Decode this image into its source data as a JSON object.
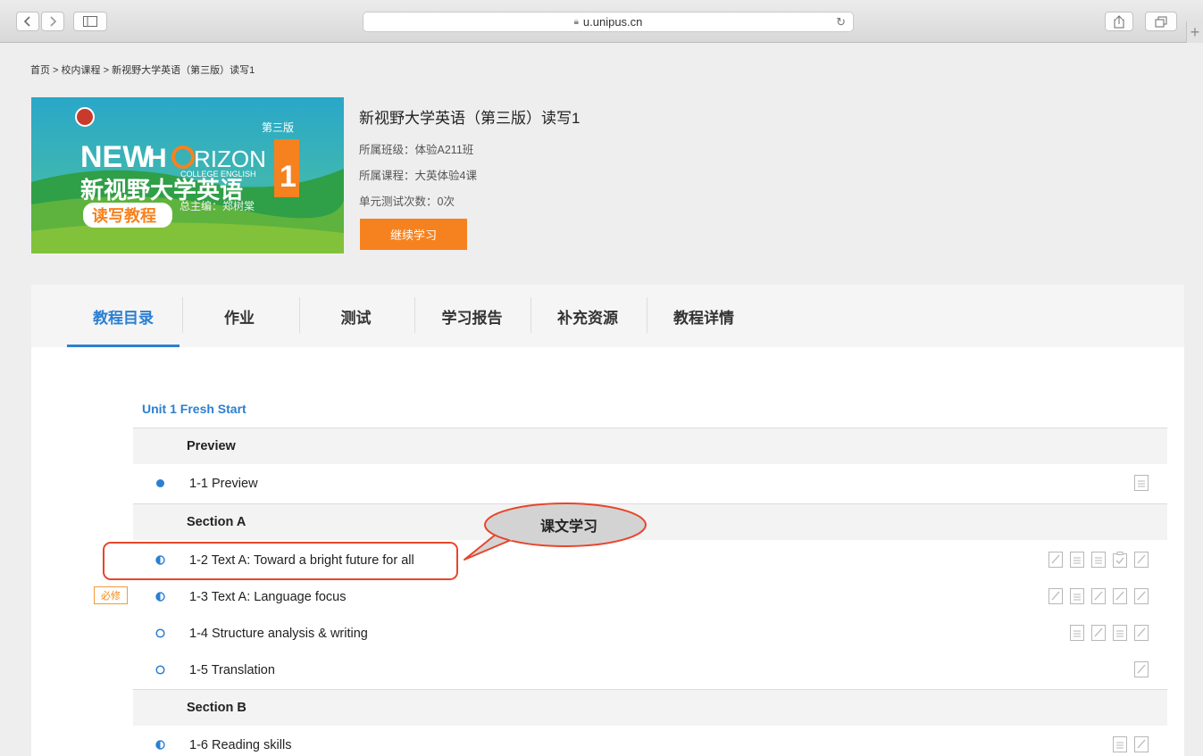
{
  "browser": {
    "url": "u.unipus.cn",
    "lock_icon": "lock-icon",
    "reload_icon": "reload-icon",
    "share_icon": "share-icon",
    "tabs_icon": "tabs-icon",
    "new_tab_label": "+"
  },
  "breadcrumb": "首页 > 校内课程 > 新视野大学英语（第三版）读写1",
  "cover": {
    "brand_new": "NEW",
    "brand_horizon": "H",
    "brand_rizon": "RIZON",
    "edition": "第三版",
    "college_english": "COLLEGE ENGLISH",
    "volume": "1",
    "cn_title": "新视野大学英语",
    "tag": "读写教程",
    "editor": "总主编：郑树棠"
  },
  "course": {
    "title": "新视野大学英语（第三版）读写1",
    "class_info": "所属班级：体验A211班",
    "course_info": "所属课程：大英体验4课",
    "tests_info": "单元测试次数：0次",
    "continue_label": "继续学习"
  },
  "tabs": [
    {
      "label": "教程目录",
      "active": true
    },
    {
      "label": "作业",
      "active": false
    },
    {
      "label": "测试",
      "active": false
    },
    {
      "label": "学习报告",
      "active": false
    },
    {
      "label": "补充资源",
      "active": false
    },
    {
      "label": "教程详情",
      "active": false
    }
  ],
  "unit_title": "Unit 1 Fresh Start",
  "sections": {
    "preview": "Preview",
    "section_a": "Section A",
    "section_b": "Section B"
  },
  "items": [
    {
      "label": "1-1 Preview",
      "progress": "complete",
      "icons": [
        "doc-icon"
      ]
    },
    {
      "label": "1-2 Text A: Toward a bright future for all",
      "progress": "half",
      "icons": [
        "edit-icon",
        "doc-icon",
        "doc-icon",
        "check-doc-icon",
        "edit-icon"
      ]
    },
    {
      "label": "1-3 Text A: Language focus",
      "progress": "half",
      "required_badge": "必修",
      "icons": [
        "edit-icon",
        "doc-icon",
        "edit-icon",
        "edit-icon",
        "edit-icon"
      ]
    },
    {
      "label": "1-4 Structure analysis & writing",
      "progress": "none",
      "icons": [
        "doc-icon",
        "edit-icon",
        "doc-icon",
        "edit-icon"
      ]
    },
    {
      "label": "1-5 Translation",
      "progress": "none",
      "icons": [
        "edit-icon"
      ]
    },
    {
      "label": "1-6 Reading skills",
      "progress": "half",
      "icons": [
        "doc-icon",
        "edit-icon"
      ]
    }
  ],
  "annotation": {
    "callout": "课文学习"
  },
  "colors": {
    "accent_blue": "#2b7fd2",
    "orange": "#f6821f",
    "highlight_red": "#e8452b"
  }
}
